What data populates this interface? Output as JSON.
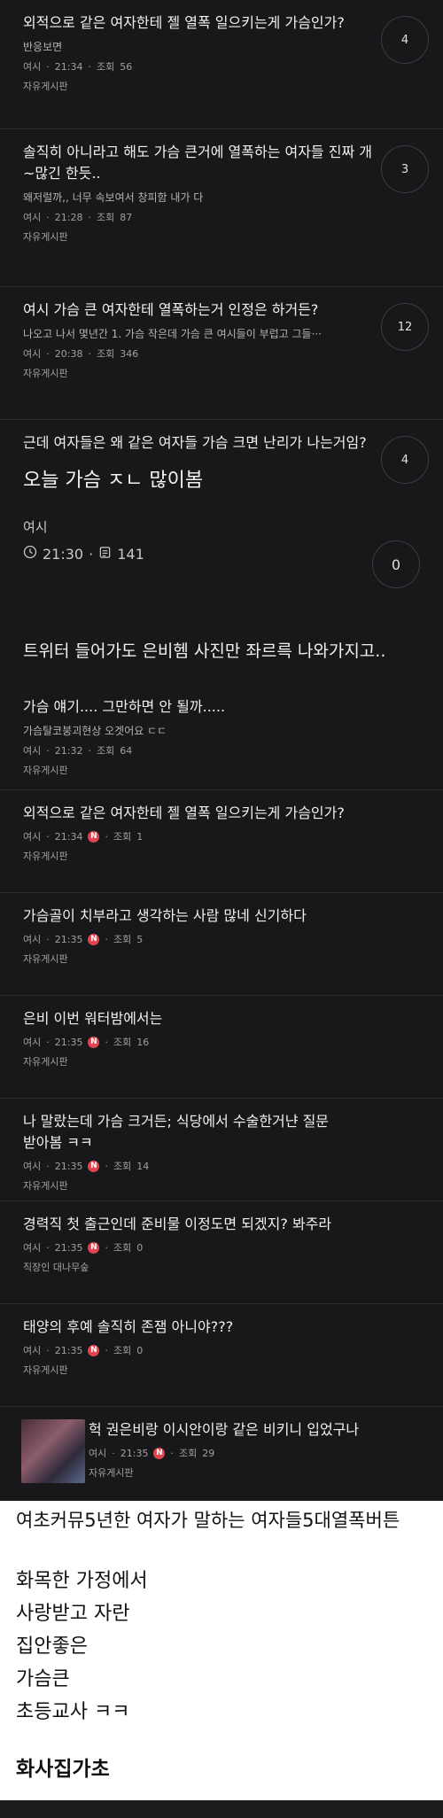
{
  "posts_top": [
    {
      "title": "외적으로 같은 여자한테 젤 열폭 일으키는게 가슴인가?",
      "preview": "반응보면",
      "author": "여시",
      "time": "21:34",
      "views_label": "조회",
      "views": "56",
      "board": "자유게시판",
      "comments": "4"
    },
    {
      "title": "솔직히 아니라고 해도 가슴 큰거에 열폭하는 여자들 진짜 개~많긴 한듯..",
      "preview": "왜저럴까,, 너무 속보여서 창피함 내가 다",
      "author": "여시",
      "time": "21:28",
      "views_label": "조회",
      "views": "87",
      "board": "자유게시판",
      "comments": "3"
    },
    {
      "title": "여시 가슴 큰 여자한테 열폭하는거 인정은 하거든?",
      "preview": "나오고 나서 몇년간 1. 가슴 작은데 가슴 큰 여시들이 부럽고 그들···",
      "author": "여시",
      "time": "20:38",
      "views_label": "조회",
      "views": "346",
      "board": "자유게시판",
      "comments": "12"
    }
  ],
  "featured": {
    "title": "근데 여자들은 왜 같은 여자들 가슴 크면 난리가 나는거임?",
    "headline": "오늘 가슴 ㅈㄴ 많이봄",
    "author": "여시",
    "time": "21:30",
    "views": "141",
    "comments_top": "4",
    "comments_bottom": "0"
  },
  "section_title": "트위터 들어가도 은비헴 사진만 좌르륵 나와가지고..",
  "posts_bottom": [
    {
      "title": "가슴 얘기.... 그만하면 안 될까.....",
      "title_bold_prefix": "가슴",
      "preview": "가슴탈코붕괴현상 오겟어요 ㄷㄷ",
      "author": "여시",
      "time": "21:32",
      "views_label": "조회",
      "views": "64",
      "board": "자유게시판",
      "new": false
    },
    {
      "title": "외적으로 같은 여자한테 젤 열폭 일으키는게 가슴인가?",
      "author": "여시",
      "time": "21:34",
      "views_label": "조회",
      "views": "1",
      "board": "자유게시판",
      "new": true
    },
    {
      "title": "가슴골이 치부라고 생각하는 사람 많네 신기하다",
      "author": "여시",
      "time": "21:35",
      "views_label": "조회",
      "views": "5",
      "board": "자유게시판",
      "new": true
    },
    {
      "title": "은비 이번 워터밤에서는",
      "author": "여시",
      "time": "21:35",
      "views_label": "조회",
      "views": "16",
      "board": "자유게시판",
      "new": true
    },
    {
      "title": "나 말랐는데 가슴 크거든; 식당에서 수술한거냔 질문 받아봄 ㅋㅋ",
      "author": "여시",
      "time": "21:35",
      "views_label": "조회",
      "views": "14",
      "board": "자유게시판",
      "new": true
    },
    {
      "title": "경력직 첫 출근인데 준비물 이정도면 되겠지? 봐주라",
      "author": "여시",
      "time": "21:35",
      "views_label": "조회",
      "views": "0",
      "board": "직장인 대나무숲",
      "new": true
    },
    {
      "title": "태양의 후예 솔직히 존잼 아니야???",
      "author": "여시",
      "time": "21:35",
      "views_label": "조회",
      "views": "0",
      "board": "자유게시판",
      "new": true
    }
  ],
  "thumb_post": {
    "title": "헉 권은비랑 이시안이랑 같은 비키니 입었구나",
    "author": "여시",
    "time": "21:35",
    "views_label": "조회",
    "views": "29",
    "board": "자유게시판",
    "new": true
  },
  "new_badge": "N",
  "light_card": {
    "title": "여초커뮤5년한 여자가 말하는 여자들5대열폭버튼",
    "lines": [
      "화목한 가정에서",
      "사랑받고 자란",
      "집안좋은",
      "가슴큰",
      "초등교사 ㅋㅋ"
    ],
    "bold_line": "화사집가초"
  }
}
